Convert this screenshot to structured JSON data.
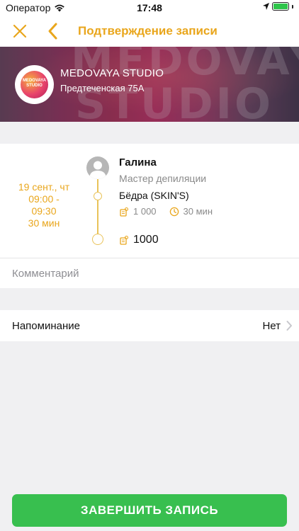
{
  "status_bar": {
    "carrier": "Оператор",
    "time": "17:48"
  },
  "nav": {
    "title": "Подтверждение записи",
    "accent_color": "#e9a61c"
  },
  "studio": {
    "name": "MEDOVAYA STUDIO",
    "address": "Предтеченская 75А",
    "logo_text_line1": "MEDOVAYA",
    "logo_text_line2": "STUDIO",
    "banner_text_line1": "MEDOVAYA",
    "banner_text_line2": "STUDIO"
  },
  "booking": {
    "date": "19 сент., чт",
    "time_range_start": "09:00 -",
    "time_range_end": "09:30",
    "duration": "30 мин",
    "master_name": "Галина",
    "master_role": "Мастер депиляции",
    "service_name": "Бёдра (SKIN'S)",
    "service_price": "1 000",
    "service_duration": "30 мин",
    "total": "1000"
  },
  "comment": {
    "placeholder": "Комментарий",
    "value": ""
  },
  "reminder": {
    "label": "Напоминание",
    "value": "Нет"
  },
  "actions": {
    "submit_label": "ЗАВЕРШИТЬ ЗАПИСЬ",
    "submit_color": "#38bf4f"
  }
}
